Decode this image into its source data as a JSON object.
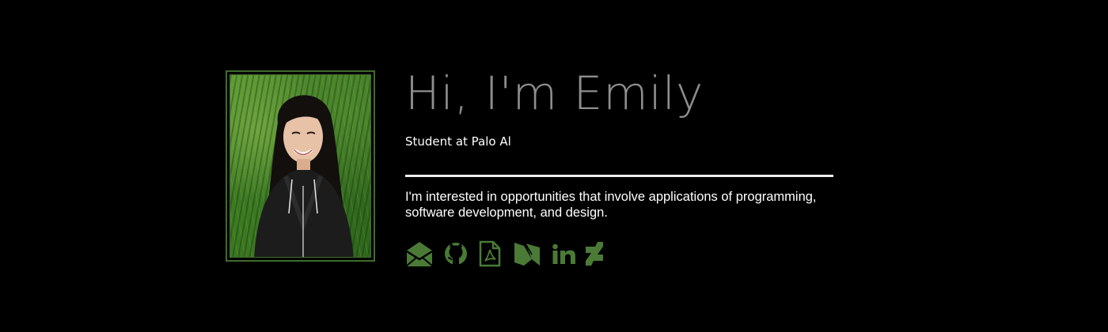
{
  "profile": {
    "heading": "Hi, I'm Emily",
    "subtitle": "Student at Palo Al",
    "bio": "I'm interested in opportunities that involve applications of programming, software development, and design.",
    "photo_alt": "Photo of Emily"
  },
  "social_links": [
    {
      "icon": "envelope-open-icon",
      "label": "Email"
    },
    {
      "icon": "github-icon",
      "label": "GitHub"
    },
    {
      "icon": "pdf-file-icon",
      "label": "Resume"
    },
    {
      "icon": "medium-icon",
      "label": "Medium"
    },
    {
      "icon": "linkedin-icon",
      "label": "LinkedIn"
    },
    {
      "icon": "deviantart-icon",
      "label": "DeviantArt"
    }
  ],
  "colors": {
    "background": "#000000",
    "accent_green": "#3f6b2b",
    "icon_green": "#4a7a36",
    "heading_gray": "#8e8e8e",
    "text_white": "#ffffff"
  }
}
